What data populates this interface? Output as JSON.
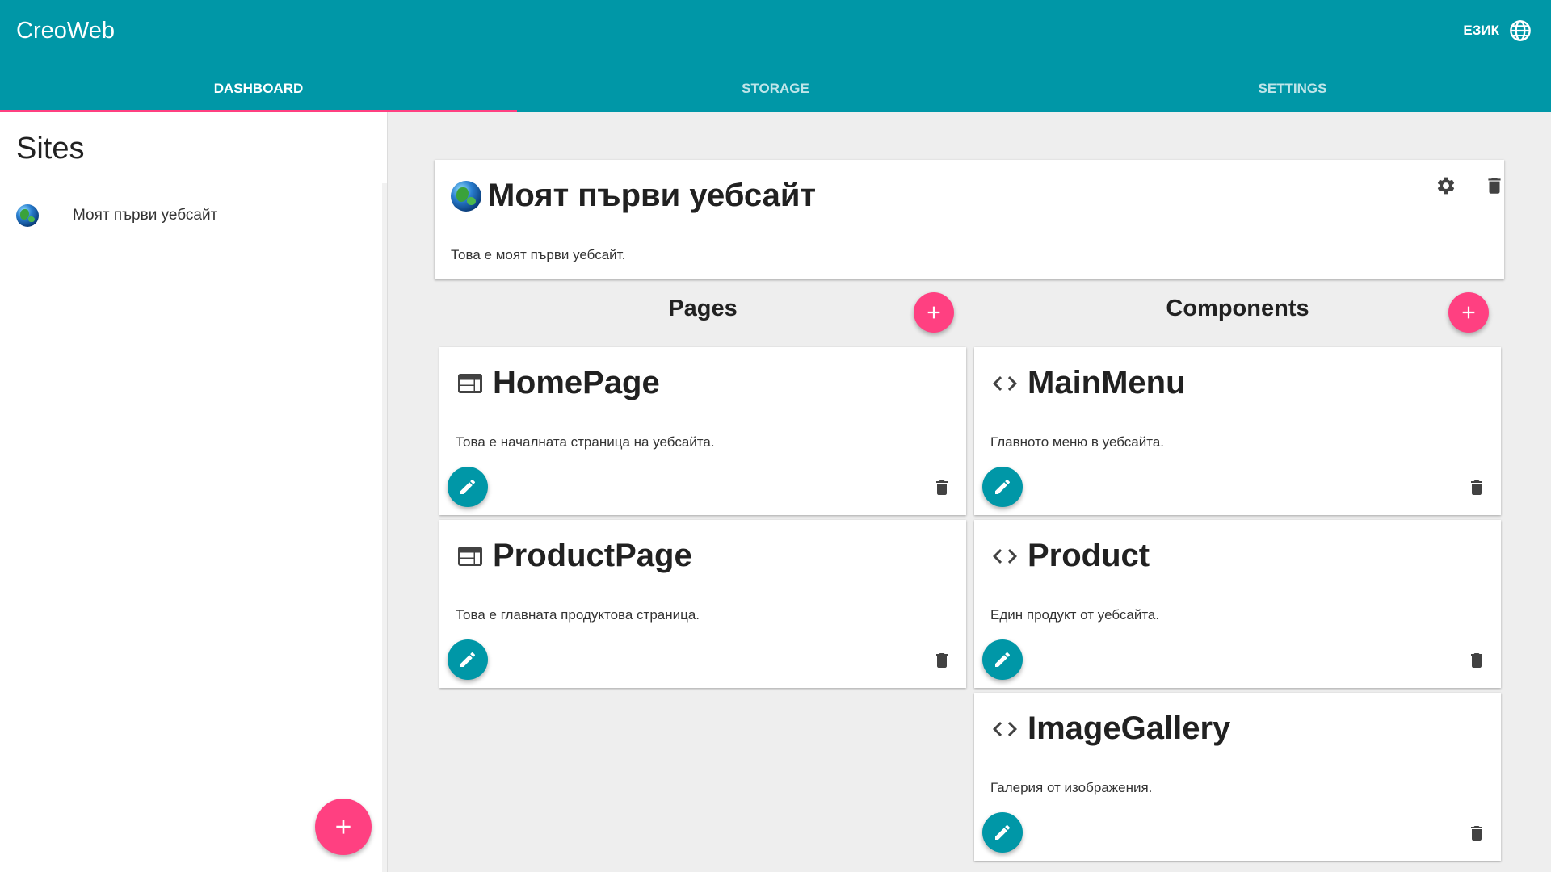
{
  "app": {
    "title": "CreoWeb",
    "language_label": "ЕЗИК"
  },
  "tabs": [
    {
      "label": "DASHBOARD",
      "active": true
    },
    {
      "label": "STORAGE",
      "active": false
    },
    {
      "label": "SETTINGS",
      "active": false
    }
  ],
  "sidebar": {
    "title": "Sites",
    "sites": [
      {
        "label": "Моят първи уебсайт",
        "icon": "globe-icon"
      }
    ]
  },
  "site": {
    "title": "Моят първи уебсайт",
    "description": "Това е моят първи уебсайт."
  },
  "pages": {
    "header": "Pages",
    "items": [
      {
        "title": "HomePage",
        "description": "Това е началната страница на уебсайта.",
        "icon": "web-page-icon"
      },
      {
        "title": "ProductPage",
        "description": "Това е главната продуктова страница.",
        "icon": "web-page-icon"
      }
    ]
  },
  "components": {
    "header": "Components",
    "items": [
      {
        "title": "MainMenu",
        "description": "Главното меню в уебсайта.",
        "icon": "code-icon"
      },
      {
        "title": "Product",
        "description": "Един продукт от уебсайта.",
        "icon": "code-icon"
      },
      {
        "title": "ImageGallery",
        "description": "Галерия от изображения.",
        "icon": "code-icon"
      }
    ]
  },
  "colors": {
    "primary": "#0097a7",
    "accent": "#ff4081",
    "background": "#eeeeee"
  }
}
